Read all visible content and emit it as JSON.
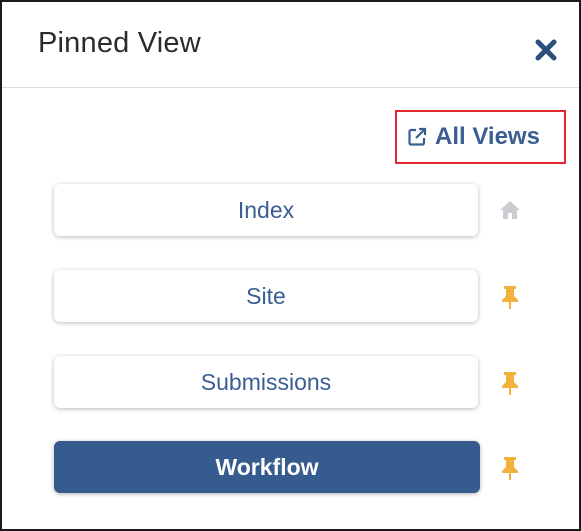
{
  "header": {
    "title": "Pinned View"
  },
  "actions": {
    "all_views_label": "All Views"
  },
  "views": [
    {
      "label": "Index",
      "icon": "home-icon",
      "active": false
    },
    {
      "label": "Site",
      "icon": "pin-icon",
      "active": false
    },
    {
      "label": "Submissions",
      "icon": "pin-icon",
      "active": false
    },
    {
      "label": "Workflow",
      "icon": "pin-icon",
      "active": true
    }
  ],
  "colors": {
    "accent": "#3a5d92",
    "active_bg": "#365b8f",
    "pin": "#f0b23a",
    "home": "#c9cdd2",
    "highlight_border": "#e3262b",
    "close": "#2d4f80"
  }
}
